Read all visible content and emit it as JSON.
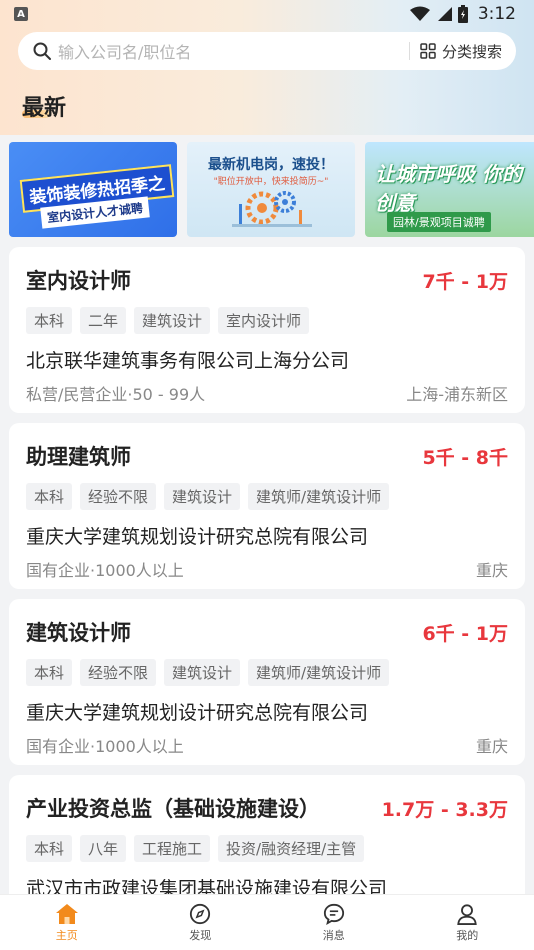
{
  "status_bar": {
    "badge": "A",
    "time": "3:12"
  },
  "search": {
    "placeholder": "输入公司名/职位名",
    "category_label": "分类搜索"
  },
  "section": {
    "title": "最新"
  },
  "banners": [
    {
      "title": "装饰装修热招季之",
      "subtitle": "室内设计人才诚聘"
    },
    {
      "title": "最新机电岗，速投！",
      "subtitle": "\"职位开放中，快来投简历~\""
    },
    {
      "title": "让城市呼吸 你的创意",
      "subtitle": "园林/景观项目诚聘"
    }
  ],
  "jobs": [
    {
      "title": "室内设计师",
      "salary": "7千 - 1万",
      "tags": [
        "本科",
        "二年",
        "建筑设计",
        "室内设计师"
      ],
      "company": "北京联华建筑事务有限公司上海分公司",
      "company_info": "私营/民营企业·50 - 99人",
      "location": "上海-浦东新区"
    },
    {
      "title": "助理建筑师",
      "salary": "5千 - 8千",
      "tags": [
        "本科",
        "经验不限",
        "建筑设计",
        "建筑师/建筑设计师"
      ],
      "company": "重庆大学建筑规划设计研究总院有限公司",
      "company_info": "国有企业·1000人以上",
      "location": "重庆"
    },
    {
      "title": "建筑设计师",
      "salary": "6千 - 1万",
      "tags": [
        "本科",
        "经验不限",
        "建筑设计",
        "建筑师/建筑设计师"
      ],
      "company": "重庆大学建筑规划设计研究总院有限公司",
      "company_info": "国有企业·1000人以上",
      "location": "重庆"
    },
    {
      "title": "产业投资总监（基础设施建设）",
      "salary": "1.7万 - 3.3万",
      "tags": [
        "本科",
        "八年",
        "工程施工",
        "投资/融资经理/主管"
      ],
      "company": "武汉市市政建设集团基础设施建设有限公司",
      "company_info": "",
      "location": ""
    }
  ],
  "tabs": [
    {
      "label": "主页",
      "icon": "home-icon",
      "active": true
    },
    {
      "label": "发现",
      "icon": "compass-icon",
      "active": false
    },
    {
      "label": "消息",
      "icon": "message-icon",
      "active": false
    },
    {
      "label": "我的",
      "icon": "user-icon",
      "active": false
    }
  ],
  "colors": {
    "accent": "#f28a1c",
    "salary": "#e8373d"
  }
}
